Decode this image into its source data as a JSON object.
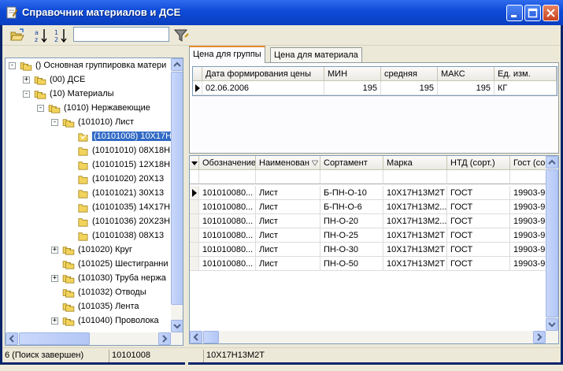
{
  "window": {
    "title": "Справочник материалов и ДСЕ"
  },
  "toolbar": {
    "open_icon": "folder-open-icon",
    "sort_az_icon": "sort-alpha-icon",
    "sort_num_icon": "sort-numeric-icon",
    "search_value": "",
    "filter_icon": "filter-icon"
  },
  "tree": {
    "items": [
      {
        "label": "() Основная группировка матери",
        "level": 0,
        "expander": "-"
      },
      {
        "label": "(00) ДСЕ",
        "level": 1,
        "expander": "+"
      },
      {
        "label": "(10) Материалы",
        "level": 1,
        "expander": "-"
      },
      {
        "label": "(1010) Нержавеющие",
        "level": 2,
        "expander": "-"
      },
      {
        "label": "(101010) Лист",
        "level": 3,
        "expander": "-"
      },
      {
        "label": "(10101008) 10Х17Н",
        "level": 4,
        "expander": "",
        "selected": true
      },
      {
        "label": "(10101010) 08Х18Н",
        "level": 4,
        "expander": ""
      },
      {
        "label": "(10101015) 12Х18Н",
        "level": 4,
        "expander": ""
      },
      {
        "label": "(10101020) 20Х13",
        "level": 4,
        "expander": ""
      },
      {
        "label": "(10101021) 30Х13",
        "level": 4,
        "expander": ""
      },
      {
        "label": "(10101035) 14Х17Н",
        "level": 4,
        "expander": ""
      },
      {
        "label": "(10101036) 20Х23Н",
        "level": 4,
        "expander": ""
      },
      {
        "label": "(10101038) 08Х13",
        "level": 4,
        "expander": ""
      },
      {
        "label": "(101020) Круг",
        "level": 3,
        "expander": "+"
      },
      {
        "label": "(101025) Шестигранни",
        "level": 3,
        "expander": ""
      },
      {
        "label": "(101030) Труба нержа",
        "level": 3,
        "expander": "+"
      },
      {
        "label": "(101032) Отводы",
        "level": 3,
        "expander": ""
      },
      {
        "label": "(101035) Лента",
        "level": 3,
        "expander": ""
      },
      {
        "label": "(101040) Проволока",
        "level": 3,
        "expander": "+"
      }
    ]
  },
  "tabs": [
    {
      "label": "Цена для группы",
      "active": true
    },
    {
      "label": "Цена для материала",
      "active": false
    }
  ],
  "price_grid": {
    "headers": [
      "Дата формирования цены",
      "МИН",
      "средняя",
      "МАКС",
      "Ед. изм."
    ],
    "rows": [
      [
        "02.06.2006",
        "195",
        "195",
        "195",
        "КГ"
      ]
    ]
  },
  "materials_grid": {
    "headers": [
      "Обозначение",
      "Наименован",
      "Сортамент",
      "Марка",
      "НТД (сорт.)",
      "Гост (со"
    ],
    "rows": [
      [
        "101010080...",
        "Лист",
        "Б-ПН-О-10",
        "10Х17Н13М2Т",
        "ГОСТ",
        "19903-9"
      ],
      [
        "101010080...",
        "Лист",
        "Б-ПН-О-6",
        "10Х17Н13М2...",
        "ГОСТ",
        "19903-9"
      ],
      [
        "101010080...",
        "Лист",
        "ПН-О-20",
        "10Х17Н13М2...",
        "ГОСТ",
        "19903-9"
      ],
      [
        "101010080...",
        "Лист",
        "ПН-О-25",
        "10Х17Н13М2Т",
        "ГОСТ",
        "19903-9"
      ],
      [
        "101010080...",
        "Лист",
        "ПН-О-30",
        "10Х17Н13М2Т",
        "ГОСТ",
        "19903-9"
      ],
      [
        "101010080...",
        "Лист",
        "ПН-О-50",
        "10Х17Н13М2Т",
        "ГОСТ",
        "19903-9"
      ]
    ]
  },
  "status": {
    "count": "6 (Поиск завершен)",
    "code": "10101008",
    "grade": "10Х17Н13М2Т"
  },
  "colors": {
    "title_bar": "#0d4ad6",
    "selection": "#316ac5",
    "tab_highlight": "#e68b2c",
    "folder": "#f2d35c"
  }
}
